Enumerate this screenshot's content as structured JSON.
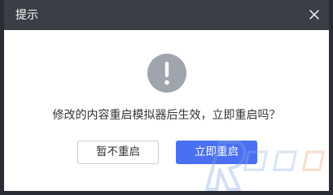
{
  "dialog": {
    "title": "提示",
    "close_icon": "close-icon",
    "warning_icon": "exclamation-circle-icon",
    "message": "修改的内容重启模拟器后生效，立即重启吗？",
    "buttons": {
      "cancel_label": "暂不重启",
      "confirm_label": "立即重启"
    }
  },
  "colors": {
    "titlebar_bg": "#3b3e45",
    "primary": "#4b6ff1",
    "warning_icon_bg": "#a0a4ad"
  }
}
